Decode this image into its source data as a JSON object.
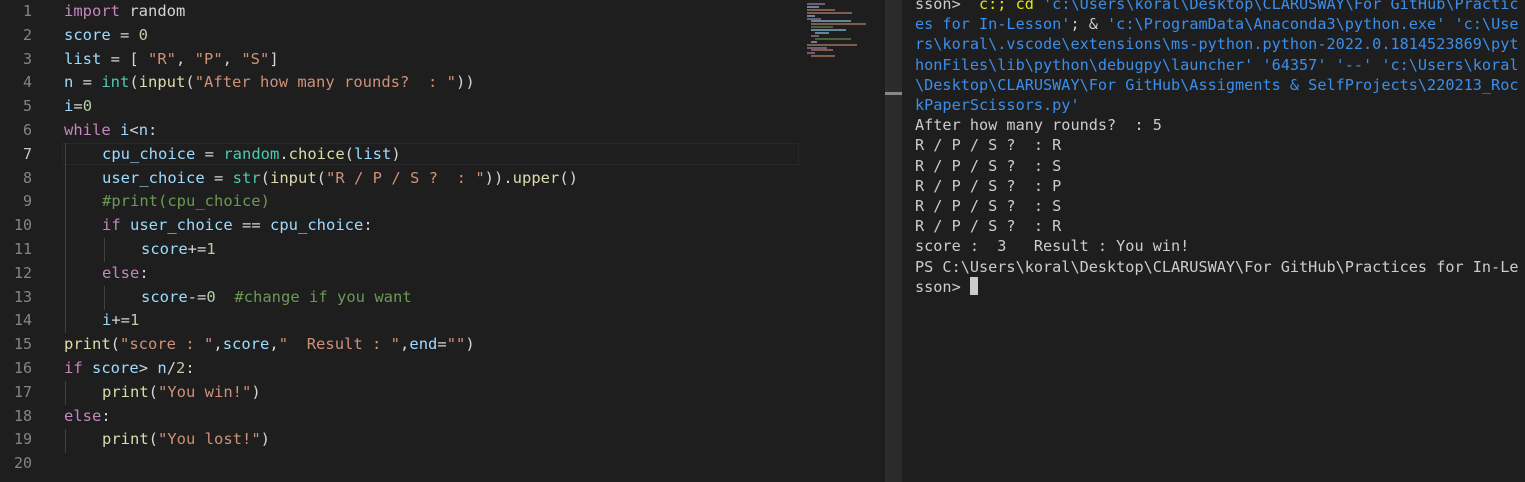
{
  "editor": {
    "line_numbers": [
      "1",
      "2",
      "3",
      "4",
      "5",
      "6",
      "7",
      "8",
      "9",
      "10",
      "11",
      "12",
      "13",
      "14",
      "15",
      "16",
      "17",
      "18",
      "19",
      "20"
    ],
    "active_line": "7"
  },
  "code": {
    "l1": {
      "kw": "import",
      "rest": " random"
    },
    "l2": {
      "var": "score",
      "op": " = ",
      "num": "0"
    },
    "l3": {
      "var": "list",
      "op": " = [ ",
      "s1": "\"R\"",
      "c1": ", ",
      "s2": "\"P\"",
      "c2": ", ",
      "s3": "\"S\"",
      "end": "]"
    },
    "l4": {
      "var": "n",
      "op": " = ",
      "f1": "int",
      "p1": "(",
      "f2": "input",
      "p2": "(",
      "str": "\"After how many rounds?  : \"",
      "end": "))"
    },
    "l5": {
      "var": "i",
      "op": "=",
      "num": "0"
    },
    "l6": {
      "kw": "while",
      "sp": " ",
      "var": "i",
      "op": "<",
      "var2": "n",
      "end": ":"
    },
    "l7": {
      "var": "cpu_choice",
      "op": " = ",
      "cls": "random",
      "dot": ".",
      "fn": "choice",
      "p": "(",
      "arg": "list",
      "end": ")"
    },
    "l8": {
      "var": "user_choice",
      "op": " = ",
      "f1": "str",
      "p1": "(",
      "f2": "input",
      "p2": "(",
      "str": "\"R / P / S ?  : \"",
      "p3": ")).",
      "fn": "upper",
      "end": "()"
    },
    "l9": {
      "cmt": "#print(cpu_choice)"
    },
    "l10": {
      "kw": "if",
      "sp": " ",
      "var": "user_choice",
      "op": " == ",
      "var2": "cpu_choice",
      "end": ":"
    },
    "l11": {
      "var": "score",
      "op": "+=",
      "num": "1"
    },
    "l12": {
      "kw": "else",
      "end": ":"
    },
    "l13": {
      "var": "score",
      "op": "-=",
      "num": "0",
      "sp": "  ",
      "cmt": "#change if you want"
    },
    "l14": {
      "var": "i",
      "op": "+=",
      "num": "1"
    },
    "l15": {
      "fn": "print",
      "p": "(",
      "s1": "\"score : \"",
      "c1": ",",
      "v1": "score",
      "c2": ",",
      "s2": "\"  Result : \"",
      "c3": ",",
      "v2": "end",
      "eq": "=",
      "s3": "\"\"",
      "end": ")"
    },
    "l16": {
      "kw": "if",
      "sp": " ",
      "var": "score",
      "op": "> ",
      "var2": "n",
      "op2": "/",
      "num": "2",
      "end": ":"
    },
    "l17": {
      "fn": "print",
      "p": "(",
      "str": "\"You win!\"",
      "end": ")"
    },
    "l18": {
      "kw": "else",
      "end": ":"
    },
    "l19": {
      "fn": "print",
      "p": "(",
      "str": "\"You lost!\"",
      "end": ")"
    }
  },
  "terminal": {
    "line1_a": "sson> ",
    "line1_b": " c:; cd ",
    "line1_c": "'c:\\Users\\koral\\Desktop\\CLARUSWAY\\For GitHub\\Practic",
    "line2_a": "es for In-Lesson'",
    "line2_b": "; & ",
    "line2_c": "'c:\\ProgramData\\Anaconda3\\python.exe' 'c:\\Use",
    "line3": "rs\\koral\\.vscode\\extensions\\ms-python.python-2022.0.1814523869\\pyt",
    "line4": "honFiles\\lib\\python\\debugpy\\launcher' '64357' '--' 'c:\\Users\\koral",
    "line5": "\\Desktop\\CLARUSWAY\\For GitHub\\Assigments & SelfProjects\\220213_Roc",
    "line6": "kPaperScissors.py'",
    "output": [
      "After how many rounds?  : 5",
      "R / P / S ?  : R",
      "R / P / S ?  : S",
      "R / P / S ?  : P",
      "R / P / S ?  : S",
      "R / P / S ?  : R",
      "score :  3   Result : You win!",
      "PS C:\\Users\\koral\\Desktop\\CLARUSWAY\\For GitHub\\Practices for In-Le"
    ],
    "prompt_end": "sson> "
  },
  "colors": {
    "background": "#1e1e1e",
    "keyword": "#c586c0",
    "function": "#dcdcaa",
    "string": "#ce9178",
    "variable": "#9cdcfe",
    "comment": "#6a9955",
    "terminal_path": "#3b8eea"
  }
}
